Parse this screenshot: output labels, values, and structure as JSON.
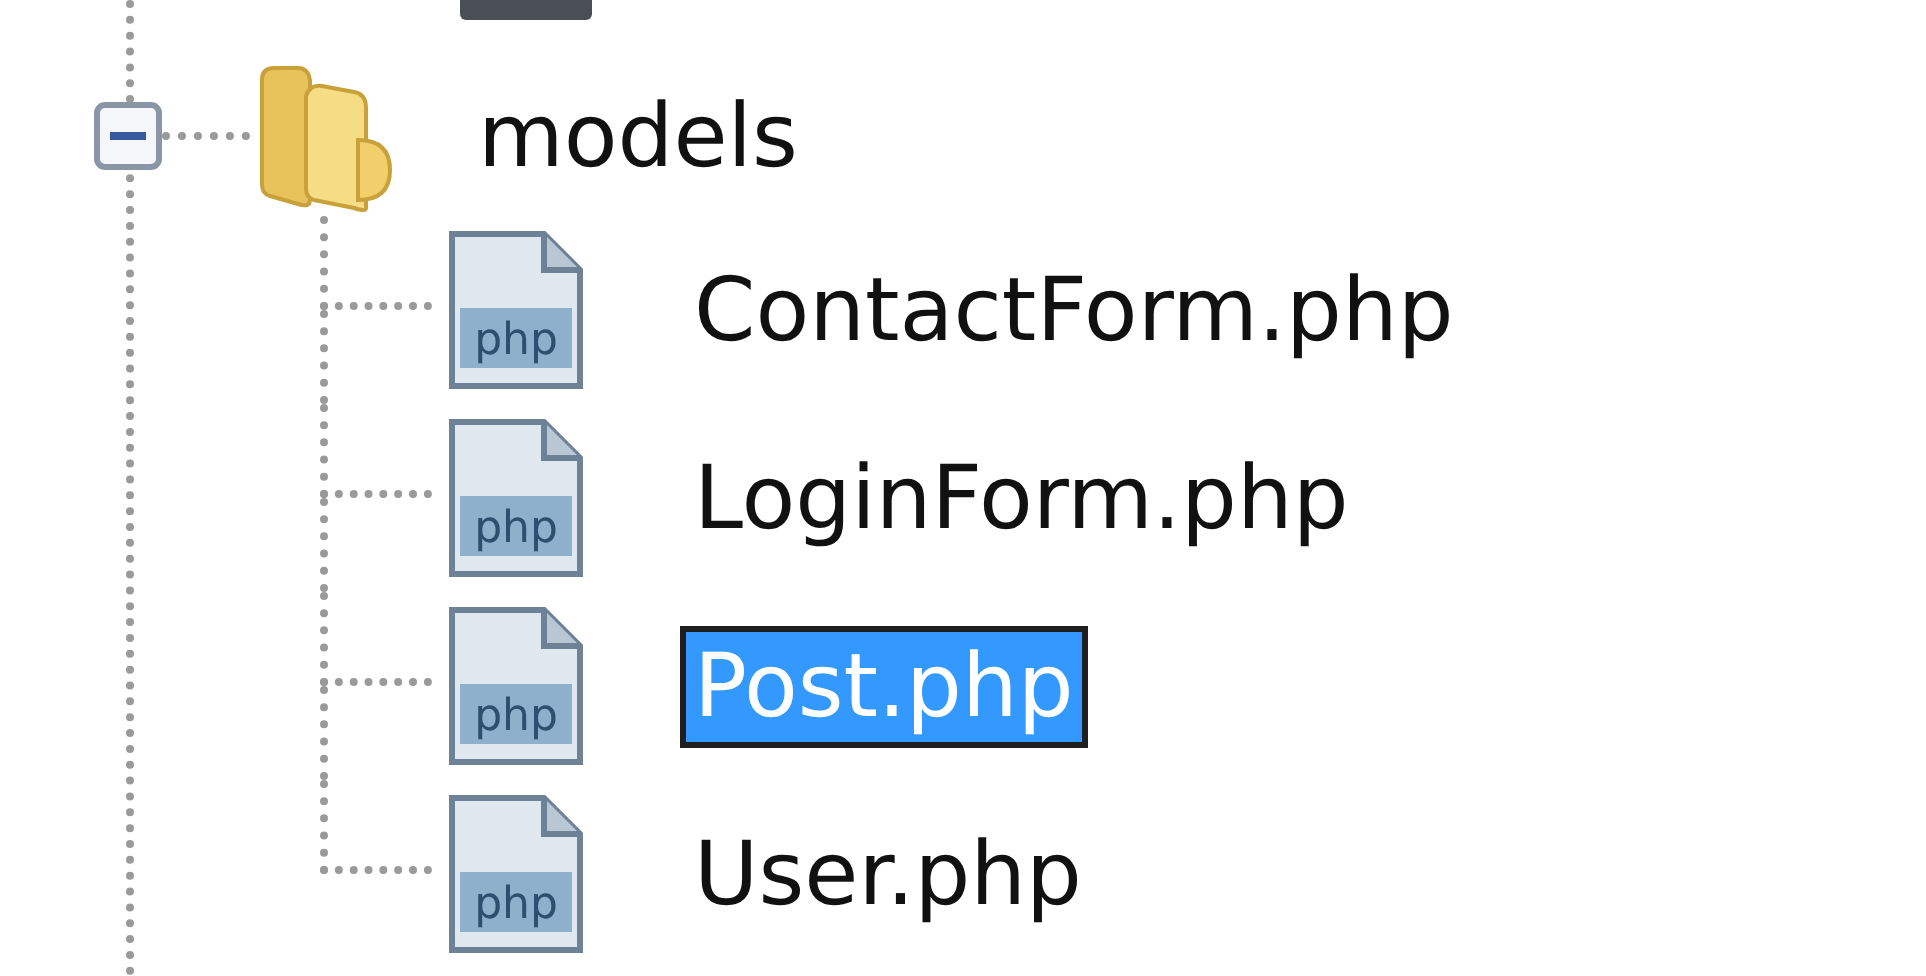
{
  "tree": {
    "items": [
      {
        "label": "models",
        "expanded": true,
        "children": [
          {
            "label": "ContactForm.php",
            "icon_text": "php",
            "selected": false
          },
          {
            "label": "LoginForm.php",
            "icon_text": "php",
            "selected": false
          },
          {
            "label": "Post.php",
            "icon_text": "php",
            "selected": true
          },
          {
            "label": "User.php",
            "icon_text": "php",
            "selected": false
          }
        ]
      }
    ]
  }
}
